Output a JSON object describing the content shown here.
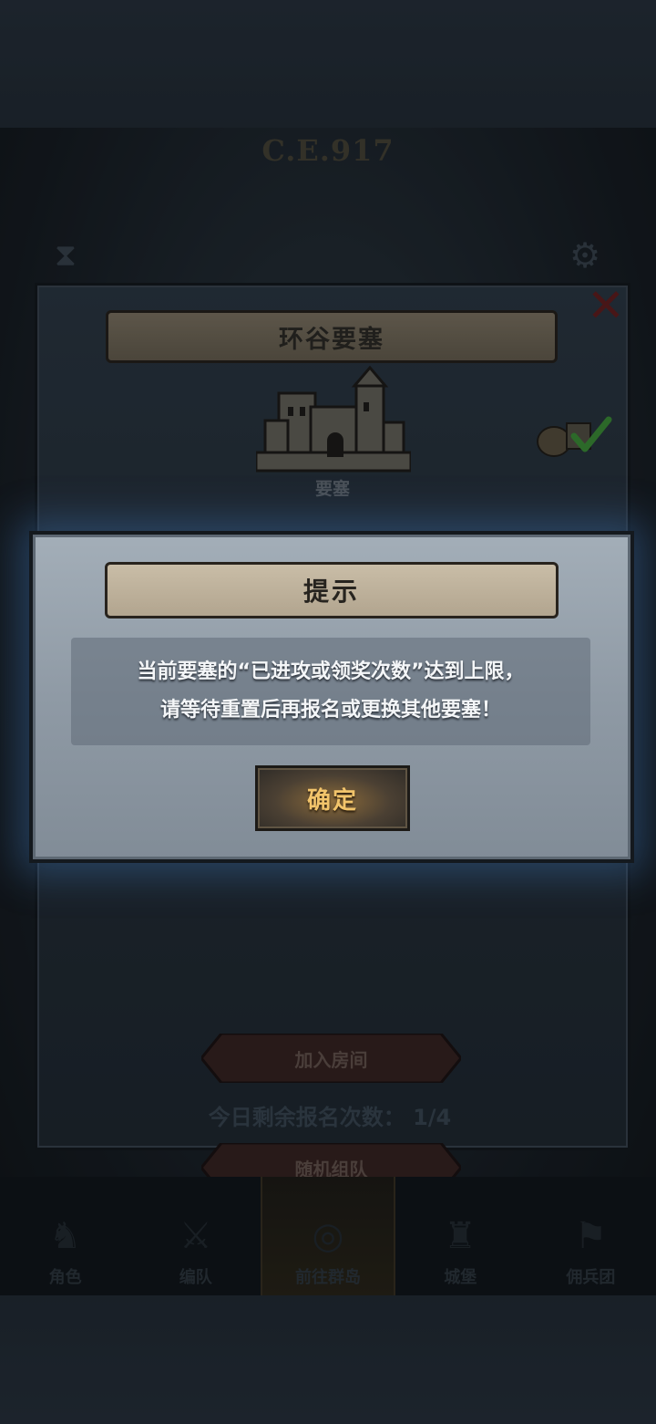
{
  "top_status": {
    "year": "C.E.917"
  },
  "panel": {
    "title": "环谷要塞",
    "castle_label": "要塞",
    "join_room_label": "加入房间",
    "random_team_label": "随机组队",
    "remaining_label": "今日剩余报名次数：",
    "remaining_value": "1/4"
  },
  "navbar": {
    "items": [
      {
        "label": "角色",
        "icon": "character-icon"
      },
      {
        "label": "编队",
        "icon": "team-icon"
      },
      {
        "label": "前往群岛",
        "icon": "islands-icon"
      },
      {
        "label": "城堡",
        "icon": "castle-icon"
      },
      {
        "label": "佣兵团",
        "icon": "mercenary-icon"
      }
    ]
  },
  "dialog": {
    "title": "提示",
    "message_line1": "当前要塞的“已进攻或领奖次数”达到上限，",
    "message_line2": "请等待重置后再报名或更换其他要塞！",
    "confirm_label": "确定"
  },
  "colors": {
    "accent_gold": "#f2c46b",
    "dialog_glow": "#3c6eaa",
    "close_red": "#6b1d1d"
  }
}
